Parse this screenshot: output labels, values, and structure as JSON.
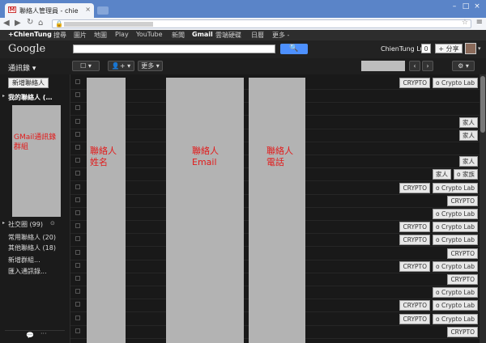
{
  "browser": {
    "tab_title": "聯絡人管理員 - chie",
    "tab_favicon": "M",
    "close_glyph": "×",
    "window_buttons": [
      "–",
      "□",
      "×"
    ]
  },
  "gbar": {
    "items": [
      "+ChienTung",
      "搜尋",
      "圖片",
      "地圖",
      "Play",
      "YouTube",
      "新聞",
      "Gmail",
      "雲端硬碟",
      "日曆",
      "更多 -"
    ]
  },
  "header": {
    "logo": "Google",
    "user": "ChienTung Lu",
    "notifications": "0",
    "share_label": "+ 分享"
  },
  "appbar": {
    "title": "通訊錄 ▾",
    "select_label": "☐ ▾",
    "add_people_label": "👤+ ▾",
    "more_label": "更多 ▾",
    "settings_label": "⚙ ▾"
  },
  "sidebar": {
    "new_contact": "新增聯絡人",
    "my_contacts": "我的聯絡人 (…",
    "groups_note": "GMail通訊錄\n群組",
    "items": [
      "社交圈 (99)",
      "常用聯絡人 (20)",
      "其他聯絡人 (18)",
      "新增群組...",
      "匯入通訊錄..."
    ]
  },
  "columns": {
    "name_note": "聯絡人\n姓名",
    "email_note": "聯絡人\nEmail",
    "phone_note": "聯絡人\n電話"
  },
  "rows": [
    [
      "CRYPTO",
      "o Crypto Lab"
    ],
    [],
    [],
    [
      "家人"
    ],
    [
      "家人"
    ],
    [],
    [
      "家人"
    ],
    [
      "家人",
      "o 家族"
    ],
    [
      "CRYPTO",
      "o Crypto Lab"
    ],
    [
      "CRYPTO"
    ],
    [
      "o Crypto Lab"
    ],
    [
      "CRYPTO",
      "o Crypto Lab"
    ],
    [
      "CRYPTO",
      "o Crypto Lab"
    ],
    [
      "CRYPTO"
    ],
    [
      "CRYPTO",
      "o Crypto Lab"
    ],
    [
      "CRYPTO"
    ],
    [
      "o Crypto Lab"
    ],
    [
      "CRYPTO",
      "o Crypto Lab"
    ],
    [
      "CRYPTO",
      "o Crypto Lab"
    ],
    [
      "CRYPTO"
    ]
  ]
}
